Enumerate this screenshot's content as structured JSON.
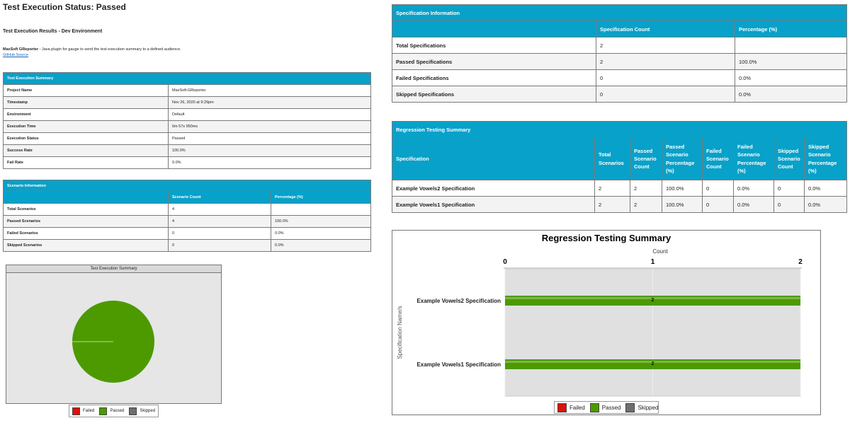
{
  "page": {
    "title": "Test Execution Status: Passed",
    "subtitle": "Test Execution Results - Dev Environment",
    "plugin_name": "MaxSoft GReporter",
    "plugin_desc": " - Java plugin for gauge to send the test execution summary to a defined audience.",
    "github_link": "GitHub Source"
  },
  "summary_table": {
    "caption": "Test Execution Summary",
    "rows": [
      {
        "label": "Project Name",
        "value": "MaxSoft-GReporter"
      },
      {
        "label": "Timestamp",
        "value": "Nov 26, 2020 at 9:29pm"
      },
      {
        "label": "Environment",
        "value": "Default"
      },
      {
        "label": "Execution Time",
        "value": "0m 57s 950ms"
      },
      {
        "label": "Execution Status",
        "value": "Passed"
      },
      {
        "label": "Success Rate",
        "value": "100.0%"
      },
      {
        "label": "Fail Rate",
        "value": "0.0%"
      }
    ]
  },
  "scenario_table": {
    "caption": "Scenario Information",
    "headers": [
      "",
      "Scenario Count",
      "Percentage (%)"
    ],
    "rows": [
      [
        "Total Scenarios",
        "4",
        ""
      ],
      [
        "Passed Scenarios",
        "4",
        "100.0%"
      ],
      [
        "Failed Scenarios",
        "0",
        "0.0%"
      ],
      [
        "Skipped Scenarios",
        "0",
        "0.0%"
      ]
    ]
  },
  "spec_table": {
    "caption": "Specification Information",
    "headers": [
      "",
      "Specification Count",
      "Percentage (%)"
    ],
    "rows": [
      [
        "Total Specifications",
        "2",
        ""
      ],
      [
        "Passed Specifications",
        "2",
        "100.0%"
      ],
      [
        "Failed Specifications",
        "0",
        "0.0%"
      ],
      [
        "Skipped Specifications",
        "0",
        "0.0%"
      ]
    ]
  },
  "regression_table": {
    "caption": "Regression Testing Summary",
    "headers": [
      "Specification",
      "Total Scenarios",
      "Passed Scenario Count",
      "Passed Scenario Percentage (%)",
      "Failed Scenario Count",
      "Failed Scenario Percentage (%)",
      "Skipped Scenario Count",
      "Skipped Scenario Percentage (%)"
    ],
    "rows": [
      [
        "Example Vowels2 Specification",
        "2",
        "2",
        "100.0%",
        "0",
        "0.0%",
        "0",
        "0.0%"
      ],
      [
        "Example Vowels1 Specification",
        "2",
        "2",
        "100.0%",
        "0",
        "0.0%",
        "0",
        "0.0%"
      ]
    ]
  },
  "legend": {
    "items": [
      {
        "label": "Failed",
        "color": "#d9120b"
      },
      {
        "label": "Passed",
        "color": "#4c9a00"
      },
      {
        "label": "Skipped",
        "color": "#6e6e6e"
      }
    ]
  },
  "chart_data": [
    {
      "type": "pie",
      "title": "Test Execution Summary",
      "labels": [
        "Failed",
        "Passed",
        "Skipped"
      ],
      "values": [
        0,
        4,
        0
      ],
      "colors": [
        "#d9120b",
        "#4c9a00",
        "#6e6e6e"
      ],
      "legend": "bottom"
    },
    {
      "type": "bar",
      "orientation": "horizontal",
      "title": "Regression Testing Summary",
      "xlabel": "Count",
      "ylabel": "Specification Name/s",
      "categories": [
        "Example Vowels2 Specification",
        "Example Vowels1 Specification"
      ],
      "series": [
        {
          "name": "Failed",
          "values": [
            0,
            0
          ],
          "color": "#d9120b"
        },
        {
          "name": "Passed",
          "values": [
            2,
            2
          ],
          "color": "#4c9a00"
        },
        {
          "name": "Skipped",
          "values": [
            0,
            0
          ],
          "color": "#6e6e6e"
        }
      ],
      "data_labels": [
        "2",
        "2"
      ],
      "xlim": [
        0,
        2
      ],
      "xticks": [
        "0",
        "1",
        "2"
      ],
      "grid": true,
      "legend": "bottom"
    }
  ]
}
